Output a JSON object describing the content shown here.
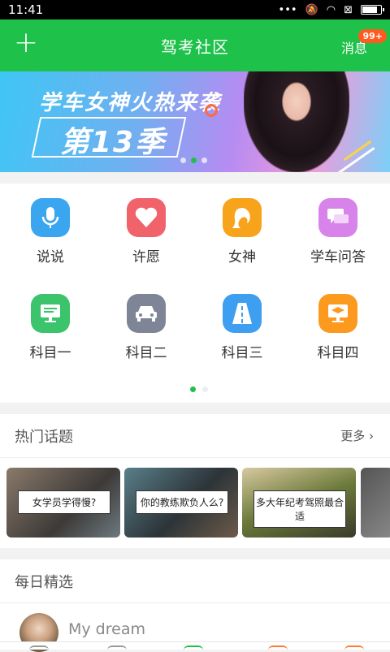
{
  "status": {
    "time": "11:41"
  },
  "appbar": {
    "title": "驾考社区",
    "messages_label": "消息",
    "badge": "99+"
  },
  "banner": {
    "headline": "学车女神火热来袭",
    "season": "第13季"
  },
  "grid": [
    {
      "label": "说说",
      "icon": "microphone-icon",
      "color": "#3aa6f0"
    },
    {
      "label": "许愿",
      "icon": "heart-icon",
      "color": "#f0636b"
    },
    {
      "label": "女神",
      "icon": "goddess-icon",
      "color": "#f8a31c"
    },
    {
      "label": "学车问答",
      "icon": "chat-bubbles-icon",
      "color": "#d783ea"
    },
    {
      "label": "科目一",
      "icon": "monitor-icon",
      "color": "#3bc46b"
    },
    {
      "label": "科目二",
      "icon": "car-icon",
      "color": "#7d8596"
    },
    {
      "label": "科目三",
      "icon": "road-icon",
      "color": "#3e9ff0"
    },
    {
      "label": "科目四",
      "icon": "graduation-screen-icon",
      "color": "#fb9a1e"
    }
  ],
  "hot": {
    "title": "热门话题",
    "more": "更多",
    "topics": [
      "女学员学得慢?",
      "你的教练欺负人么?",
      "多大年纪考驾照最合适"
    ]
  },
  "daily": {
    "title": "每日精选",
    "post_author": "My dream"
  }
}
